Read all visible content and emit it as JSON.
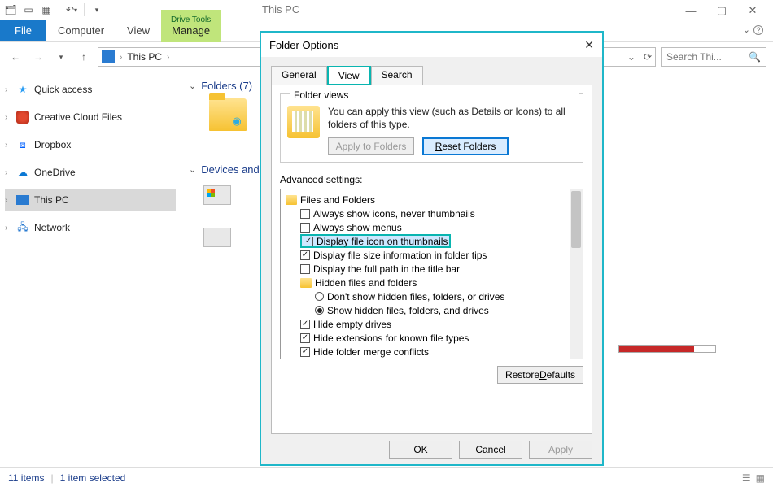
{
  "window": {
    "title": "This PC",
    "min_tooltip": "Minimize",
    "max_tooltip": "Maximize",
    "close_tooltip": "Close"
  },
  "ribbon": {
    "file": "File",
    "tabs": [
      "Computer",
      "View"
    ],
    "contextual_title": "Drive Tools",
    "contextual_tab": "Manage"
  },
  "nav": {
    "back": "Back",
    "forward": "Forward",
    "up": "Up",
    "crumb_root": "This PC",
    "search_placeholder": "Search Thi..."
  },
  "sidebar": {
    "items": [
      {
        "label": "Quick access",
        "icon": "star"
      },
      {
        "label": "Creative Cloud Files",
        "icon": "cc"
      },
      {
        "label": "Dropbox",
        "icon": "dropbox"
      },
      {
        "label": "OneDrive",
        "icon": "onedrive"
      },
      {
        "label": "This PC",
        "icon": "pc",
        "selected": true
      },
      {
        "label": "Network",
        "icon": "net"
      }
    ]
  },
  "content": {
    "folders_heading": "Folders (7)",
    "devices_heading": "Devices and"
  },
  "status": {
    "count": "11 items",
    "selected": "1 item selected"
  },
  "dialog": {
    "title": "Folder Options",
    "tabs": {
      "general": "General",
      "view": "View",
      "search": "Search"
    },
    "folder_views_legend": "Folder views",
    "folder_views_text": "You can apply this view (such as Details or Icons) to all folders of this type.",
    "apply_to_folders": "Apply to Folders",
    "reset_folders": "Reset Folders",
    "reset_folders_u": "R",
    "advanced_label": "Advanced settings:",
    "tree": {
      "root": "Files and Folders",
      "items": [
        {
          "type": "check",
          "checked": false,
          "label": "Always show icons, never thumbnails"
        },
        {
          "type": "check",
          "checked": false,
          "label": "Always show menus"
        },
        {
          "type": "check",
          "checked": true,
          "label": "Display file icon on thumbnails",
          "highlight": true
        },
        {
          "type": "check",
          "checked": true,
          "label": "Display file size information in folder tips"
        },
        {
          "type": "check",
          "checked": false,
          "label": "Display the full path in the title bar"
        },
        {
          "type": "folder",
          "label": "Hidden files and folders"
        },
        {
          "type": "radio",
          "selected": false,
          "label": "Don't show hidden files, folders, or drives",
          "indent": 2
        },
        {
          "type": "radio",
          "selected": true,
          "label": "Show hidden files, folders, and drives",
          "indent": 2
        },
        {
          "type": "check",
          "checked": true,
          "label": "Hide empty drives"
        },
        {
          "type": "check",
          "checked": true,
          "label": "Hide extensions for known file types"
        },
        {
          "type": "check",
          "checked": true,
          "label": "Hide folder merge conflicts"
        }
      ]
    },
    "restore_defaults": "Restore Defaults",
    "restore_defaults_u": "D",
    "ok": "OK",
    "cancel": "Cancel",
    "apply": "Apply",
    "apply_u": "A"
  }
}
